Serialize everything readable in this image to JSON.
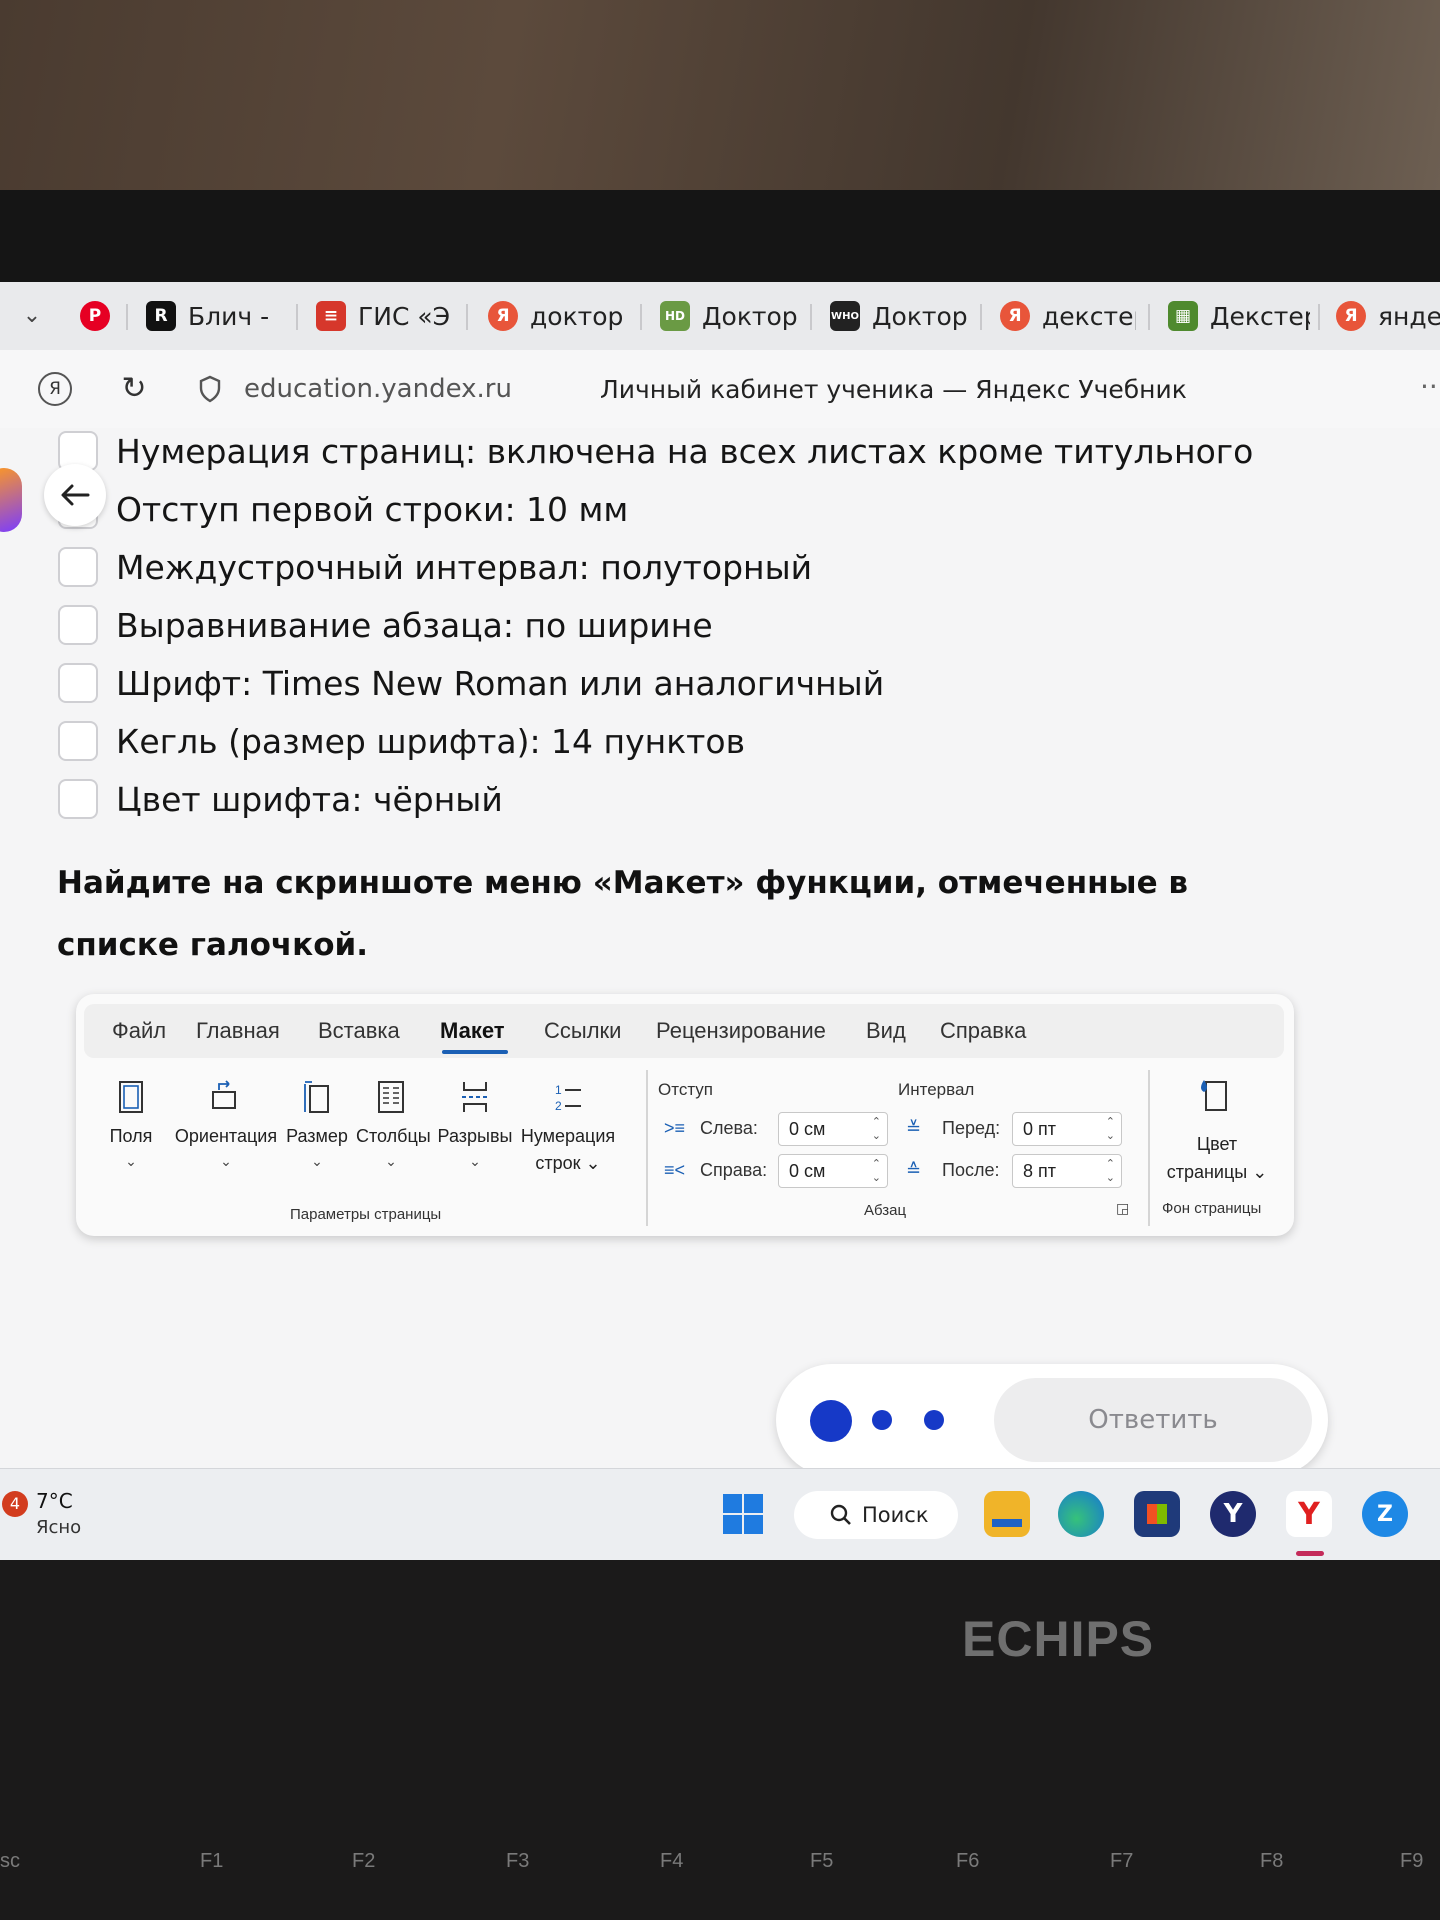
{
  "browser": {
    "tabs": [
      {
        "label": "Блич - с",
        "icon": "R",
        "icon_color": "#111111"
      },
      {
        "label": "ГИС «Эл",
        "icon": "≡",
        "icon_color": "#d6372b"
      },
      {
        "label": "доктор",
        "icon": "Я",
        "icon_color": "#e8553a"
      },
      {
        "label": "Доктор",
        "icon": "HD",
        "icon_color": "#6a9a44"
      },
      {
        "label": "Доктор",
        "icon": "WHO",
        "icon_color": "#222222"
      },
      {
        "label": "декстер",
        "icon": "Я",
        "icon_color": "#e8553a"
      },
      {
        "label": "Декстер",
        "icon": "▦",
        "icon_color": "#4f8a2e"
      },
      {
        "label": "яндек",
        "icon": "Я",
        "icon_color": "#e8553a"
      }
    ],
    "url": "education.yandex.ru",
    "page_title": "Личный кабинет ученика — Яндекс Учебник"
  },
  "checklist": [
    "Нумерация страниц: включена на всех листах кроме титульного",
    "Отступ первой строки: 10 мм",
    "Междустрочный интервал: полуторный",
    "Выравнивание абзаца: по ширине",
    "Шрифт: Times New Roman или аналогичный",
    "Кегль (размер шрифта): 14 пунктов",
    "Цвет шрифта: чёрный"
  ],
  "question": "Найдите на скриншоте меню «Макет» функции, отмеченные в списке галочкой.",
  "ribbon": {
    "tabs": [
      "Файл",
      "Главная",
      "Вставка",
      "Макет",
      "Ссылки",
      "Рецензирование",
      "Вид",
      "Справка"
    ],
    "active_tab": "Макет",
    "buttons": [
      {
        "label": "Поля",
        "caret": "⌄"
      },
      {
        "label": "Ориентация",
        "caret": "⌄"
      },
      {
        "label": "Размер",
        "caret": "⌄"
      },
      {
        "label": "Столбцы",
        "caret": "⌄"
      },
      {
        "label": "Разрывы",
        "caret": "⌄"
      },
      {
        "label": "Нумерация",
        "label2": "строк ⌄"
      }
    ],
    "group_page": "Параметры страницы",
    "indent_header": "Отступ",
    "interval_header": "Интервал",
    "left_label": "Слева:",
    "left_value": "0 см",
    "right_label": "Справа:",
    "right_value": "0 см",
    "before_label": "Перед:",
    "before_value": "0 пт",
    "after_label": "После:",
    "after_value": "8 пт",
    "group_paragraph": "Абзац",
    "color_label1": "Цвет",
    "color_label2": "страницы ⌄",
    "group_background": "Фон страницы"
  },
  "answer_button": "Ответить",
  "taskbar": {
    "weather_badge": "4",
    "temperature": "7°C",
    "condition": "Ясно",
    "search": "Поиск"
  },
  "laptop": {
    "brand": "ECHIPS",
    "fkeys": [
      "sc",
      "F1",
      "F2",
      "F3",
      "F4",
      "F5",
      "F6",
      "F7",
      "F8",
      "F9"
    ]
  }
}
